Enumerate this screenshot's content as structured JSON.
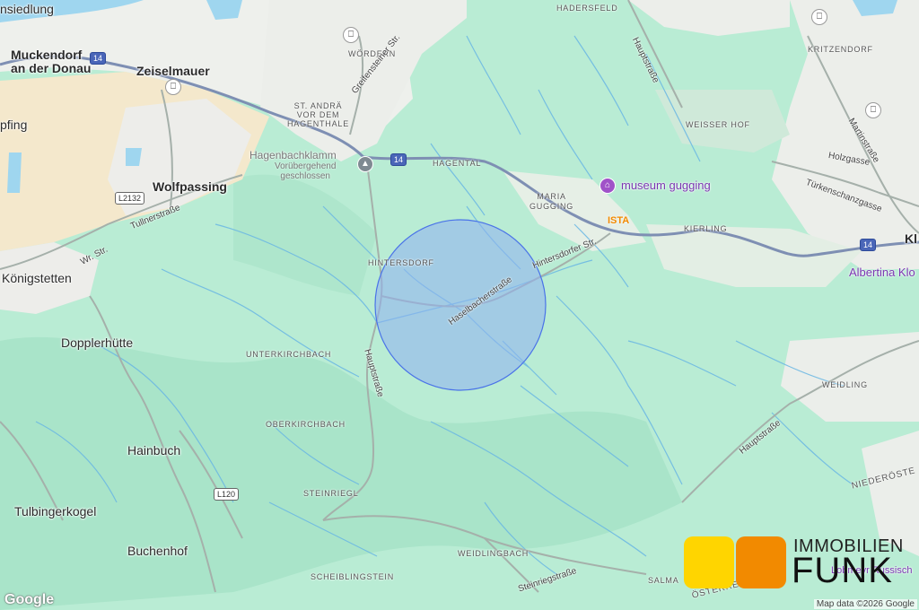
{
  "colors": {
    "land": "#b9ecd4",
    "forest_dark": "#a8e3c8",
    "urban": "#f1f1ee",
    "field": "#f4e5c8",
    "water": "#9fd6ef",
    "highway": "#7e8fb3",
    "road": "#9aa7a1",
    "stream": "#6ab7e4",
    "circle_fill": "#8fb0f0",
    "circle_stroke": "#4a73e8",
    "logo_yellow": "#ffd500",
    "logo_orange": "#f28a00"
  },
  "towns": {
    "muckendorf": "Muckendorf\nan der Donau",
    "zeiselmauer": "Zeiselmauer",
    "siedlung": "nsiedlung",
    "pfing": "pfing",
    "wolfpassing": "Wolfpassing",
    "koenigstetten": "Königstetten",
    "dopplerhuette": "Dopplerhütte",
    "hainbuch": "Hainbuch",
    "tulbingerkogel": "Tulbingerkogel",
    "buchenhof": "Buchenhof",
    "kl": "Kl"
  },
  "small_labels": {
    "hadersfeld": "HADERSFELD",
    "woerdern": "WÖRDERN",
    "st_andrae": "ST. ANDRÄ\nVOR DEM\nHAGENTHALE",
    "kritzendorf": "KRITZENDORF",
    "weisser_hof": "WEISSER HOF",
    "hagental": "HAGENTAL",
    "maria_gugging": "MARIA\nGUGGING",
    "kierling": "KIERLING",
    "hintersdorf": "HINTERSDORF",
    "unterkirchbach": "UNTERKIRCHBACH",
    "oberkirchbach": "OBERKIRCHBACH",
    "steinriegl": "STEINRIEGL",
    "weidling": "WEIDLING",
    "weidlingbach": "WEIDLINGBACH",
    "scheiblingstein": "SCHEIBLINGSTEIN",
    "salma": "SALMA",
    "niederoest": "NIEDERÖSTE",
    "oesterreich": "ÖSTERREICH"
  },
  "streets": {
    "greifensteiner": "Greifensteiner Str.",
    "hauptstrasse_n": "Hauptstraße",
    "martinstrasse": "Martinstraße",
    "holzgasse": "Holzgasse",
    "tuerkenschanz": "Türkenschanzgasse",
    "tullnerstrasse": "Tullnerstraße",
    "wr_str": "Wr. Str.",
    "hintersdorfer": "Hintersdorfer Str.",
    "haselbacher": "Haselbacherstraße",
    "hauptstrasse_mid": "Hauptstraße",
    "hauptstrasse_se": "Hauptstraße",
    "steinriegl": "Steinriegstraße"
  },
  "pois": {
    "hagenbachklamm_title": "Hagenbachklamm",
    "hagenbachklamm_status": "Vorübergehend\ngeschlossen",
    "museum": "museum gugging",
    "ista": "ISTA",
    "albertina": "Albertina Klo",
    "lobmeyr": "Lobmeyr Russisch"
  },
  "shields": {
    "s14a": "14",
    "s14b": "14",
    "s14c": "14",
    "l2132": "L2132",
    "l120": "L120"
  },
  "branding": {
    "google": "Google",
    "attribution": "Map data ©2026 Google",
    "logo_line1": "IMMOBILIEN",
    "logo_line2": "FUNK"
  }
}
